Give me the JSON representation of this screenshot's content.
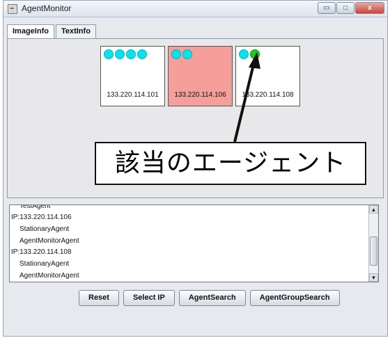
{
  "window": {
    "title": "AgentMonitor",
    "controls": {
      "minimize": "▭",
      "maximize": "□",
      "close": "x"
    }
  },
  "tabs": [
    {
      "label": "ImageInfo",
      "active": true
    },
    {
      "label": "TextInfo",
      "active": false
    }
  ],
  "agents": [
    {
      "ip": "133.220.114.101",
      "highlighted": false,
      "dots": [
        "cyan",
        "cyan",
        "cyan",
        "cyan"
      ]
    },
    {
      "ip": "133.220.114.106",
      "highlighted": true,
      "dots": [
        "cyan",
        "cyan"
      ]
    },
    {
      "ip": "133.220.114.108",
      "highlighted": false,
      "dots": [
        "cyan",
        "green"
      ]
    }
  ],
  "callout": {
    "text": "該当のエージェント"
  },
  "log": {
    "lines": [
      "TestAgent",
      "IP:133.220.114.106",
      "StationaryAgent",
      "AgentMonitorAgent",
      "IP:133.220.114.108",
      "StationaryAgent",
      "AgentMonitorAgent"
    ]
  },
  "buttons": {
    "reset": "Reset",
    "select_ip": "Select IP",
    "agent_search": "AgentSearch",
    "agent_group_search": "AgentGroupSearch"
  },
  "colors": {
    "agent_dot": "#00e5ef",
    "found_dot": "#1fc91f",
    "highlight_box": "#f59e9a"
  }
}
